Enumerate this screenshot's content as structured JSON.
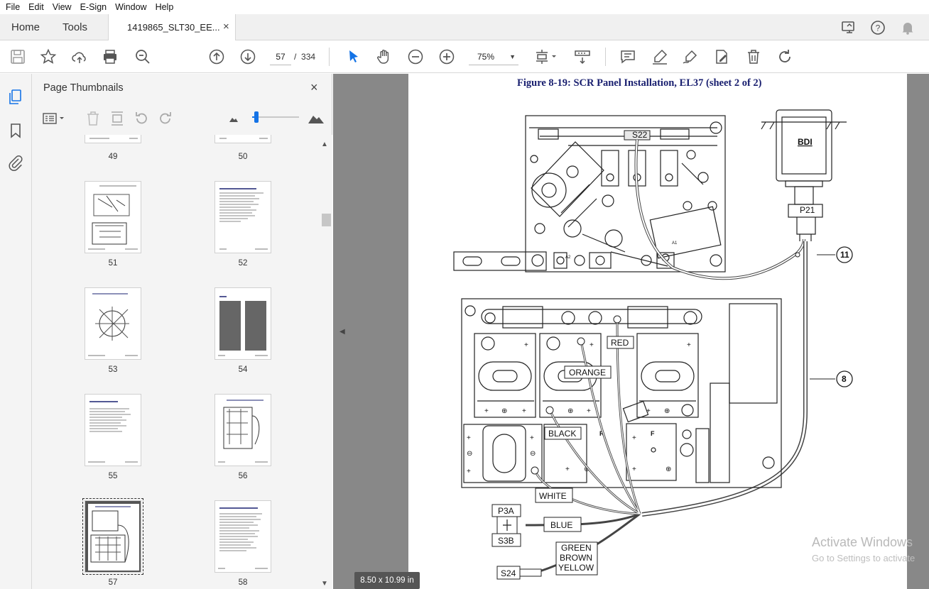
{
  "menu": [
    "File",
    "Edit",
    "View",
    "E-Sign",
    "Window",
    "Help"
  ],
  "tabs": {
    "home": "Home",
    "tools": "Tools",
    "document": "1419865_SLT30_EE...",
    "close": "×"
  },
  "toolbar": {
    "current_page": "57",
    "page_separator": "/",
    "total_pages": "334",
    "zoom": "75%"
  },
  "panel": {
    "title": "Page Thumbnails",
    "close": "×"
  },
  "thumbnails": [
    {
      "label": "49"
    },
    {
      "label": "50"
    },
    {
      "label": "51"
    },
    {
      "label": "52"
    },
    {
      "label": "53"
    },
    {
      "label": "54"
    },
    {
      "label": "55"
    },
    {
      "label": "56"
    },
    {
      "label": "57",
      "selected": true
    },
    {
      "label": "58"
    }
  ],
  "document": {
    "figure_title": "Figure 8-19:  SCR Panel Installation, EL37 (sheet 2 of 2)",
    "page_size": "8.50 x 10.99 in",
    "callouts": {
      "s22": "S22",
      "bdi": "BDI",
      "p21": "P21",
      "c11": "11",
      "c8": "8",
      "red": "RED",
      "orange": "ORANGE",
      "black": "BLACK",
      "white": "WHITE",
      "p3a": "P3A",
      "s3b": "S3B",
      "blue": "BLUE",
      "gby1": "GREEN",
      "gby2": "BROWN",
      "gby3": "YELLOW",
      "s24": "S24",
      "f": "F",
      "r": "R",
      "a1": "A1",
      "a2": "A2"
    }
  },
  "watermark": {
    "line1": "Activate Windows",
    "line2": "Go to Settings to activate"
  },
  "colors": {
    "accent": "#1473e6",
    "figure_title": "#1a2070",
    "doc_bg": "#888888"
  }
}
